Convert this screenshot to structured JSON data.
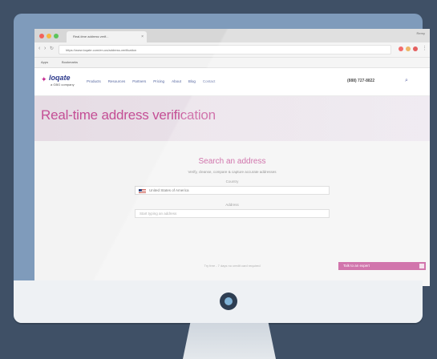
{
  "browser": {
    "tab_title": "Real-time address verif...",
    "tab_close": "×",
    "tabbar_right": "Remy",
    "url": "https://www.loqate.com/en-us/address-verification",
    "bookmarks_label": "Apps",
    "bookmarks_item": "Bookmarks"
  },
  "site": {
    "logo_name": "loqate",
    "logo_sub": "a GBG company",
    "menu": [
      "Products",
      "Resources",
      "Partners",
      "Pricing",
      "About",
      "Blog",
      "Contact"
    ],
    "phone": "(888) 727-8822"
  },
  "hero": {
    "title": "Real-time address verification"
  },
  "search": {
    "title": "Search an address",
    "subtitle": "Verify, cleanse, compare & capture accurate addresses",
    "country_label": "Country",
    "country_value": "United States of America",
    "address_label": "Address",
    "address_placeholder": "Start typing an address",
    "footnote": "Try free - 7 days no credit card required"
  },
  "widget": {
    "label": "Talk to an expert"
  },
  "colors": {
    "accent": "#c44e95",
    "brand_navy": "#2d3a8c",
    "bezel": "#7f9bbb",
    "background": "#3f5066"
  }
}
